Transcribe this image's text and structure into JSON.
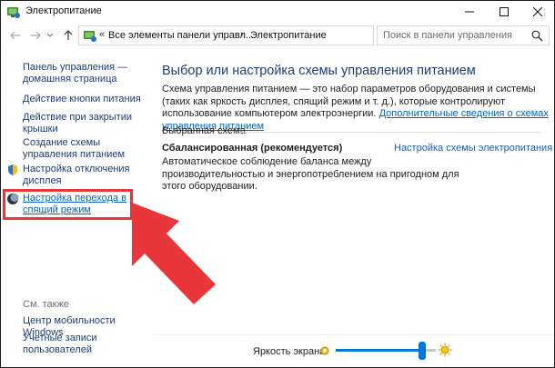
{
  "window": {
    "title": "Электропитание"
  },
  "nav": {
    "breadcrumb_root": "Все элементы панели управл...",
    "breadcrumb_current": "Электропитание",
    "search_placeholder": "Поиск в панели управления"
  },
  "sidebar": {
    "items": [
      {
        "label": "Панель управления — домашняя страница"
      },
      {
        "label": "Действие кнопки питания"
      },
      {
        "label": "Действие при закрытии крышки"
      },
      {
        "label": "Создание схемы управления питанием"
      },
      {
        "label": "Настройка отключения дисплея"
      },
      {
        "label": "Настройка перехода в спящий режим"
      }
    ],
    "see_also_title": "См. также",
    "see_also": [
      {
        "label": "Центр мобильности Windows"
      },
      {
        "label": "Учетные записи пользователей"
      }
    ]
  },
  "main": {
    "title": "Выбор или настройка схемы управления питанием",
    "description": "Схема управления питанием — это набор параметров оборудования и системы (таких как яркость дисплея, спящий режим и т. д.), которые контролируют использование компьютером электроэнергии.",
    "description_link": "Дополнительные сведения о схемах управления питанием",
    "section_label": "Выбранная схема",
    "plan": {
      "name": "Сбалансированная (рекомендуется)",
      "settings_link": "Настройка схемы электропитания",
      "description": "Автоматическое соблюдение баланса между производительностью и энергопотреблением на пригодном для этого оборудовании."
    }
  },
  "footer": {
    "brightness_label": "Яркость экрана:",
    "brightness_level": 0.86
  },
  "colors": {
    "highlight": "#e8363a",
    "link": "#1a3d7c",
    "accent": "#0078d7"
  }
}
